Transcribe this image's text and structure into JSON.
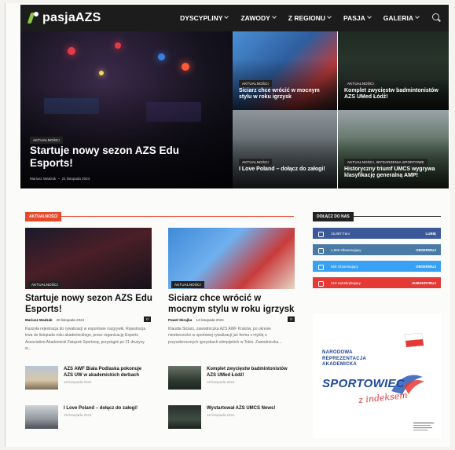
{
  "nav": {
    "logo": "pasjaAZS",
    "items": [
      {
        "label": "DYSCYPLINY"
      },
      {
        "label": "ZAWODY"
      },
      {
        "label": "Z REGIONU"
      },
      {
        "label": "PASJA"
      },
      {
        "label": "GALERIA"
      }
    ]
  },
  "hero": {
    "main": {
      "category": "AKTUALNOŚCI",
      "title": "Startuje nowy sezon AZS Edu Esports!",
      "author": "Mariusz Wadzak",
      "date": "21 listopada 2024"
    },
    "tiles": [
      {
        "category": "AKTUALNOŚCI",
        "title": "Siciarz chce wrócić w mocnym stylu w roku igrzysk"
      },
      {
        "category": "AKTUALNOŚCI",
        "title": "Komplet zwycięstw badmintonistów AZS UMed Łódź!"
      },
      {
        "category": "AKTUALNOŚCI",
        "title": "I Love Poland – dołącz do załogi!"
      },
      {
        "category": "AKTUALNOŚCI, WYDARZENIA SPORTOWE",
        "title": "Historyczny triumf UMCS wygrywa klasyfikację generalną AMP!"
      }
    ]
  },
  "news": {
    "header": "AKTUALNOŚCI",
    "cards": [
      {
        "category": "AKTUALNOŚCI",
        "title": "Startuje nowy sezon AZS Edu Esports!",
        "author": "Mariusz Wadzak",
        "date": "20 listopada 2024",
        "comments": "0",
        "excerpt": "Ruszyła rejestracja do rywalizacji w esportowe rozgrywki. Rejestracja trwa do listopada roku akademickiego, przez organizację Esports Association Akademicki Związek Sportowy, przystąpić po 21 drużyny w..."
      },
      {
        "category": "AKTUALNOŚCI",
        "title": "Siciarz chce wrócić w mocnym stylu w roku igrzysk",
        "author": "Paweł Skrajba",
        "date": "14 listopada 2024",
        "comments": "0",
        "excerpt": "Klaudia Siciarz, zawodniczka AZS AWF Kraków, po okresie nieobecności w sportowej rywalizacji już forma z myślą o przyszłorocznych igrzyskach olimpijskich w Tokio. Zawodniczka..."
      }
    ],
    "minis": [
      {
        "title": "AZS AWF Biała Podlaska pokonuje AZS UW w akademickich derbach",
        "date": "18 listopada 2024"
      },
      {
        "title": "Komplet zwycięstw badmintonistów AZS UMed Łódź!",
        "date": "18 listopada 2024"
      },
      {
        "title": "I Love Poland – dołącz do załogi!",
        "date": "18 listopada 2024"
      },
      {
        "title": "Wystartował AZS UMCS News!",
        "date": "18 listopada 2024"
      }
    ]
  },
  "sidebar": {
    "header": "DOŁĄCZ DO NAS",
    "social": [
      {
        "name": "facebook-icon",
        "count": "15,887 Fani",
        "action": "LUBIĘ",
        "color": "#3b5998"
      },
      {
        "name": "instagram-icon",
        "count": "1,865 Obserwujący",
        "action": "OBSERWUJ",
        "color": "#4a7aa6"
      },
      {
        "name": "twitter-icon",
        "count": "565 Obserwujący",
        "action": "OBSERWUJ",
        "color": "#38a1f3"
      },
      {
        "name": "youtube-icon",
        "count": "210 Subskrybujący",
        "action": "SUBSKRYBUJ",
        "color": "#e53935"
      }
    ],
    "ad": {
      "line1": "Narodowa reprezentacja akademicka",
      "line2": "SPORTOWIEC",
      "line3": "z indeksem"
    }
  }
}
